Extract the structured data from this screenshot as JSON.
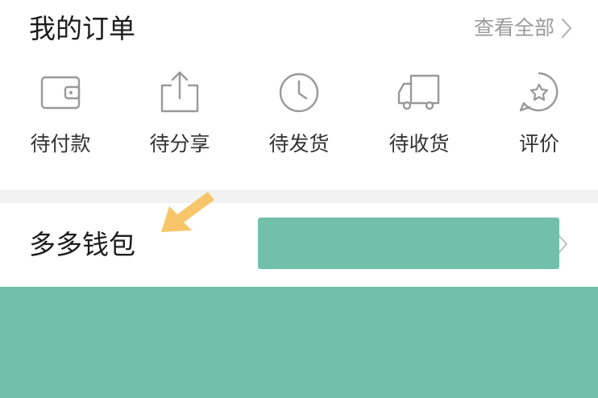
{
  "orders": {
    "title": "我的订单",
    "view_all_label": "查看全部",
    "statuses": [
      {
        "label": "待付款",
        "icon": "wallet-icon"
      },
      {
        "label": "待分享",
        "icon": "share-icon"
      },
      {
        "label": "待发货",
        "icon": "clock-icon"
      },
      {
        "label": "待收货",
        "icon": "truck-icon"
      },
      {
        "label": "评价",
        "icon": "star-bubble-icon"
      }
    ]
  },
  "wallet": {
    "title": "多多钱包"
  },
  "colors": {
    "text_primary": "#1c1c1c",
    "text_secondary": "#9a9a9a",
    "icon_gray": "#999999",
    "divider": "#f2f2f2",
    "redaction": "#72c0a9",
    "annotation_arrow": "#f7c66a"
  }
}
